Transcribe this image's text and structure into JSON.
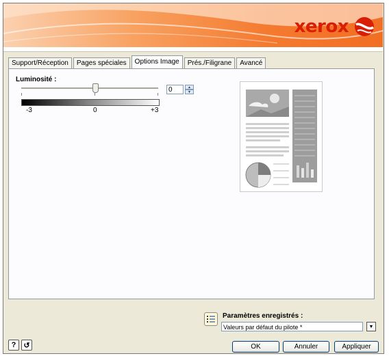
{
  "brand": {
    "name": "xerox"
  },
  "tabs": [
    {
      "label": "Support/Réception"
    },
    {
      "label": "Pages spéciales"
    },
    {
      "label": "Options Image"
    },
    {
      "label": "Prés./Filigrane"
    },
    {
      "label": "Avancé"
    }
  ],
  "luminosity": {
    "label": "Luminosité :",
    "value": "0",
    "scale_min": "-3",
    "scale_mid": "0",
    "scale_max": "+3"
  },
  "saved_settings": {
    "label": "Paramètres enregistrés :",
    "value": "Valeurs par défaut du pilote *"
  },
  "footer": {
    "help": "?",
    "reset": "↺",
    "ok": "OK",
    "cancel": "Annuler",
    "apply": "Appliquer"
  },
  "colors": {
    "brand_red": "#d81e05",
    "banner_orange": "#f47a2f"
  }
}
